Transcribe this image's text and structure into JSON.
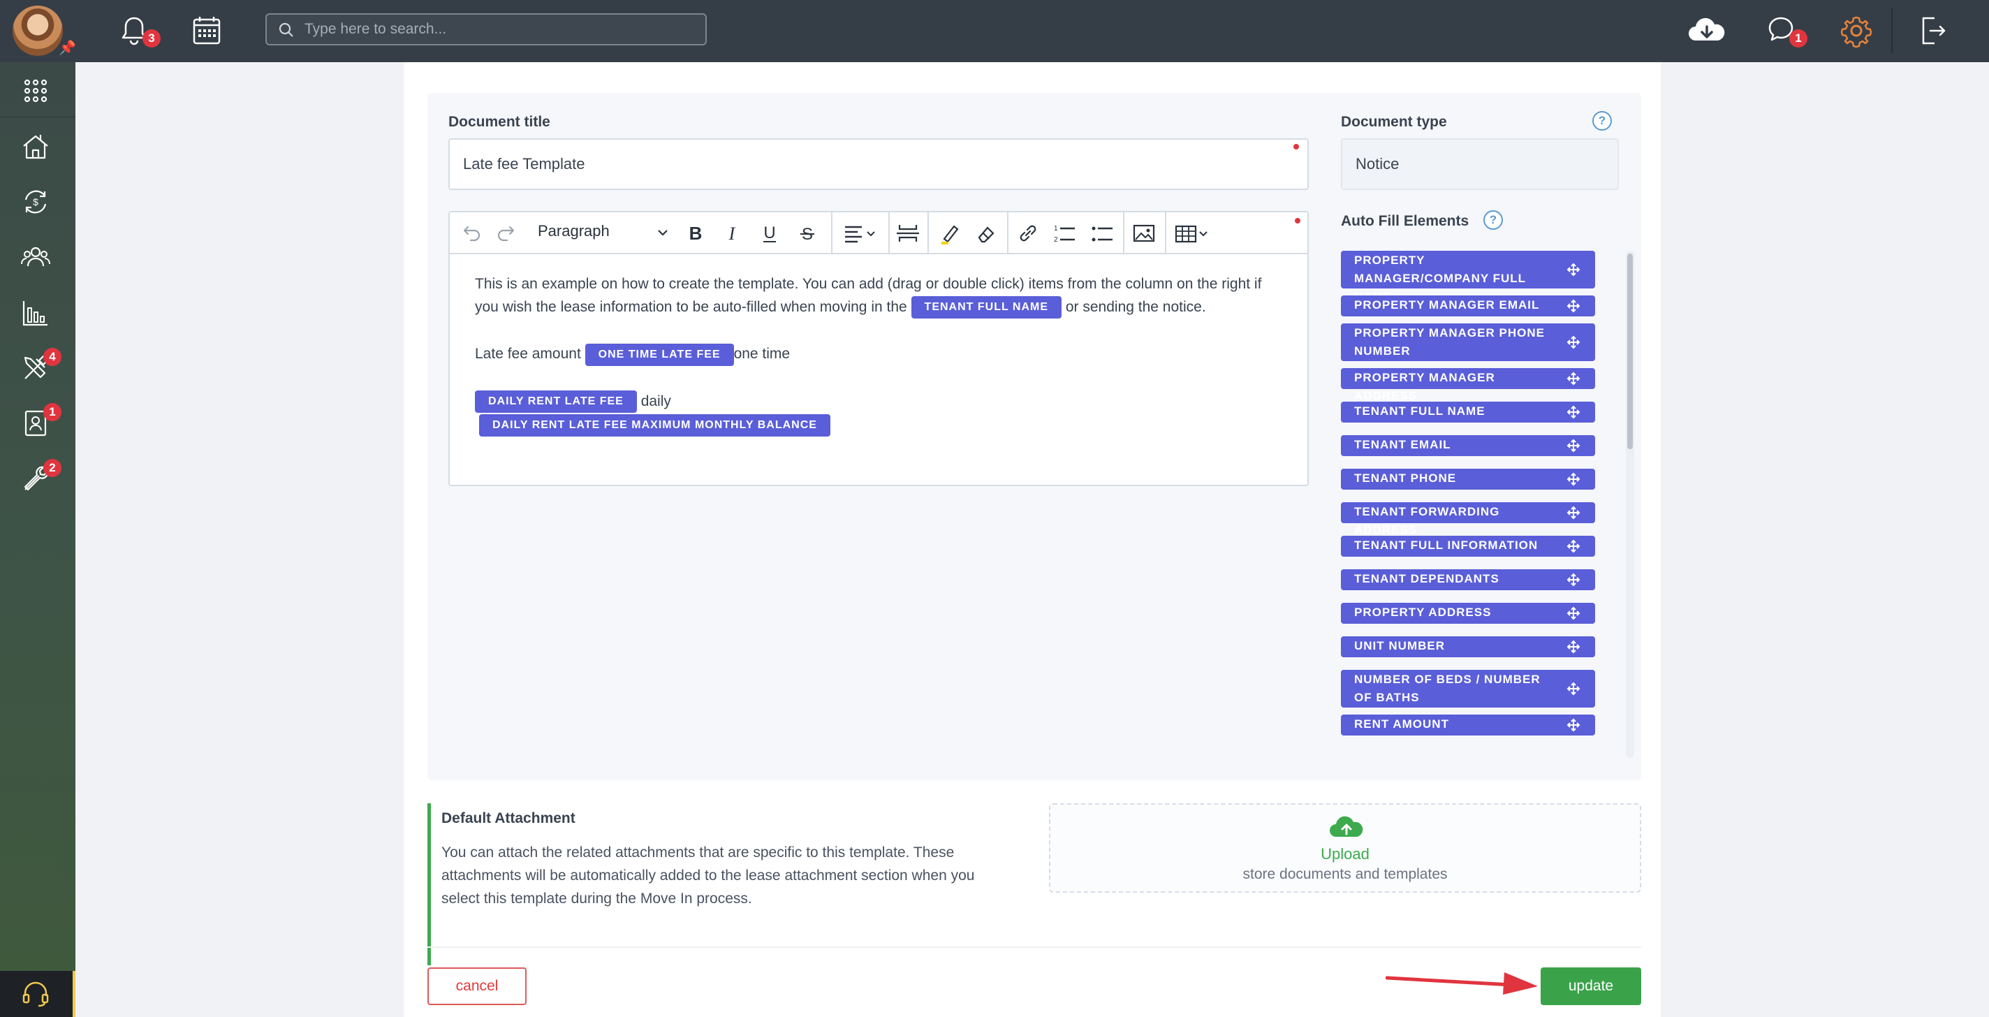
{
  "topbar": {
    "notifications_badge": "3",
    "search_placeholder": "Type here to search...",
    "messages_badge": "1",
    "icons": [
      "bell-icon",
      "calendar-icon",
      "search-icon",
      "cloud-download-icon",
      "chat-icon",
      "gear-icon",
      "logout-icon"
    ]
  },
  "sidebar": {
    "items": [
      {
        "icon": "apps-grid-icon",
        "badge": ""
      },
      {
        "icon": "property-icon",
        "badge": ""
      },
      {
        "icon": "payments-cycle-icon",
        "badge": ""
      },
      {
        "icon": "people-icon",
        "badge": ""
      },
      {
        "icon": "reports-chart-icon",
        "badge": ""
      },
      {
        "icon": "tools-icon",
        "badge": "4"
      },
      {
        "icon": "tenant-card-icon",
        "badge": "1"
      },
      {
        "icon": "tools-wrench-icon",
        "badge": "2"
      }
    ],
    "support_icon": "headset-icon"
  },
  "form": {
    "document_title_label": "Document title",
    "document_title_value": "Late fee Template",
    "document_type_label": "Document type",
    "document_type_value": "Notice",
    "help_mark": "?",
    "editor": {
      "paragraph_style": "Paragraph",
      "content": {
        "line1_text": "This is an example on how to create the template. You can add (drag or double click) items from the column on the right if you wish the lease information to be auto-filled when moving in the",
        "line1_chip": "TENANT FULL NAME",
        "line1_tail": "or sending the notice.",
        "line2_text": "Late fee amount",
        "line2_chip": "ONE TIME LATE FEE",
        "line2_tail": "one time",
        "line3_chip": "DAILY RENT LATE FEE",
        "line3_tail": "daily",
        "line4_chip": "DAILY RENT LATE FEE MAXIMUM MONTHLY BALANCE"
      }
    },
    "auto_fill_label": "Auto Fill Elements",
    "auto_fill_items": [
      "PROPERTY MANAGER/COMPANY FULL NAME",
      "PROPERTY MANAGER EMAIL",
      "PROPERTY MANAGER PHONE NUMBER",
      "PROPERTY MANAGER ADDRESS",
      "TENANT FULL NAME",
      "TENANT EMAIL",
      "TENANT PHONE",
      "TENANT FORWARDING ADDRESS",
      "TENANT FULL INFORMATION",
      "TENANT DEPENDANTS",
      "PROPERTY ADDRESS",
      "UNIT NUMBER",
      "NUMBER OF BEDS / NUMBER OF BATHS",
      "RENT AMOUNT"
    ]
  },
  "attachment": {
    "title": "Default Attachment",
    "description": "You can attach the related attachments that are specific to this template. These attachments will be automatically added to the lease attachment section when you select this template during the Move In process.",
    "upload_label": "Upload",
    "upload_sub": "store documents and templates"
  },
  "actions": {
    "cancel_label": "cancel",
    "update_label": "update"
  },
  "colors": {
    "topbar": "#353e47",
    "chip": "#5a5ed8",
    "success": "#3aa34a",
    "danger": "#e0353f",
    "accent_gear": "#e8833a"
  }
}
